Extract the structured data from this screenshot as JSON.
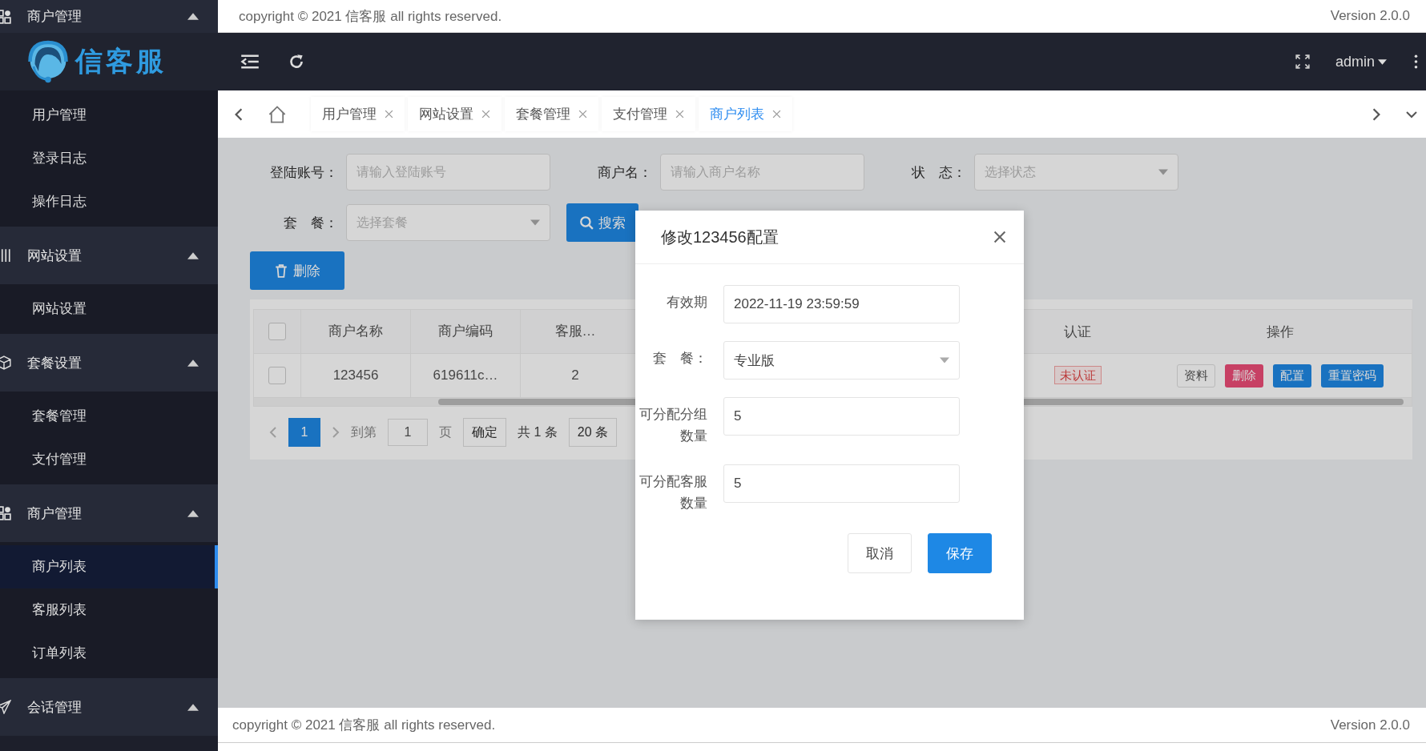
{
  "top_strip": {
    "sidebar_group": {
      "label": "商户管理",
      "expanded": true
    },
    "copyright": "copyright © 2021 信客服 all rights reserved.",
    "version": "Version 2.0.0"
  },
  "header": {
    "logo_text": "信客服",
    "user": "admin"
  },
  "sidebar": {
    "loose_items": [
      {
        "label": "用户管理",
        "selected": false
      },
      {
        "label": "登录日志",
        "selected": false
      },
      {
        "label": "操作日志",
        "selected": false
      }
    ],
    "groups": [
      {
        "label": "网站设置",
        "expanded": true,
        "items": [
          {
            "label": "网站设置",
            "selected": false
          }
        ]
      },
      {
        "label": "套餐设置",
        "expanded": true,
        "items": [
          {
            "label": "套餐管理",
            "selected": false
          },
          {
            "label": "支付管理",
            "selected": false
          }
        ]
      },
      {
        "label": "商户管理",
        "expanded": true,
        "items": [
          {
            "label": "商户列表",
            "selected": true
          },
          {
            "label": "客服列表",
            "selected": false
          },
          {
            "label": "订单列表",
            "selected": false
          }
        ]
      },
      {
        "label": "会话管理",
        "expanded": true
      }
    ]
  },
  "tabs": [
    {
      "label": "用户管理",
      "selected": false
    },
    {
      "label": "网站设置",
      "selected": false
    },
    {
      "label": "套餐管理",
      "selected": false
    },
    {
      "label": "支付管理",
      "selected": false
    },
    {
      "label": "商户列表",
      "selected": true
    }
  ],
  "filters": [
    {
      "label": "登陆账号：",
      "placeholder": "请输入登陆账号",
      "kind": "input"
    },
    {
      "label": "商户名：",
      "placeholder": "请输入商户名称",
      "kind": "input"
    },
    {
      "label": "状　态：",
      "placeholder": "选择状态",
      "kind": "select"
    },
    {
      "label": "套　餐：",
      "placeholder": "选择套餐",
      "kind": "select"
    }
  ],
  "search_button": "搜索",
  "delete_button": "删除",
  "table": {
    "select_all_checked": false,
    "columns_left": [
      "商户名称",
      "商户编码",
      "客服…"
    ],
    "columns_right": [
      "认证",
      "操作"
    ],
    "rows": [
      {
        "checked": false,
        "cells": [
          "123456",
          "619611c…",
          "2"
        ],
        "auth": "未认证",
        "actions": [
          {
            "label": "资料",
            "kind": "default"
          },
          {
            "label": "删除",
            "kind": "danger"
          },
          {
            "label": "配置",
            "kind": "primary"
          },
          {
            "label": "重置密码",
            "kind": "primary"
          }
        ]
      }
    ]
  },
  "pagination": {
    "pages": [
      {
        "label": "1",
        "selected": true
      }
    ],
    "goto_label": "到第",
    "goto_value": "1",
    "page_unit": "页",
    "confirm": "确定",
    "total": "共 1 条",
    "page_size": "20 条"
  },
  "dialog": {
    "title": "修改123456配置",
    "fields": [
      {
        "label": "有效期",
        "value": "2022-11-19 23:59:59",
        "kind": "input"
      },
      {
        "label": "套　餐：",
        "value": "专业版",
        "kind": "select"
      },
      {
        "label": "可分配分组数量",
        "value": "5",
        "kind": "input"
      },
      {
        "label": "可分配客服数量",
        "value": "5",
        "kind": "input"
      }
    ],
    "buttons": [
      {
        "label": "取消",
        "kind": "default"
      },
      {
        "label": "保存",
        "kind": "primary"
      }
    ]
  },
  "footer": {
    "copyright": "copyright © 2021 信客服 all rights reserved.",
    "version": "Version 2.0.0"
  }
}
